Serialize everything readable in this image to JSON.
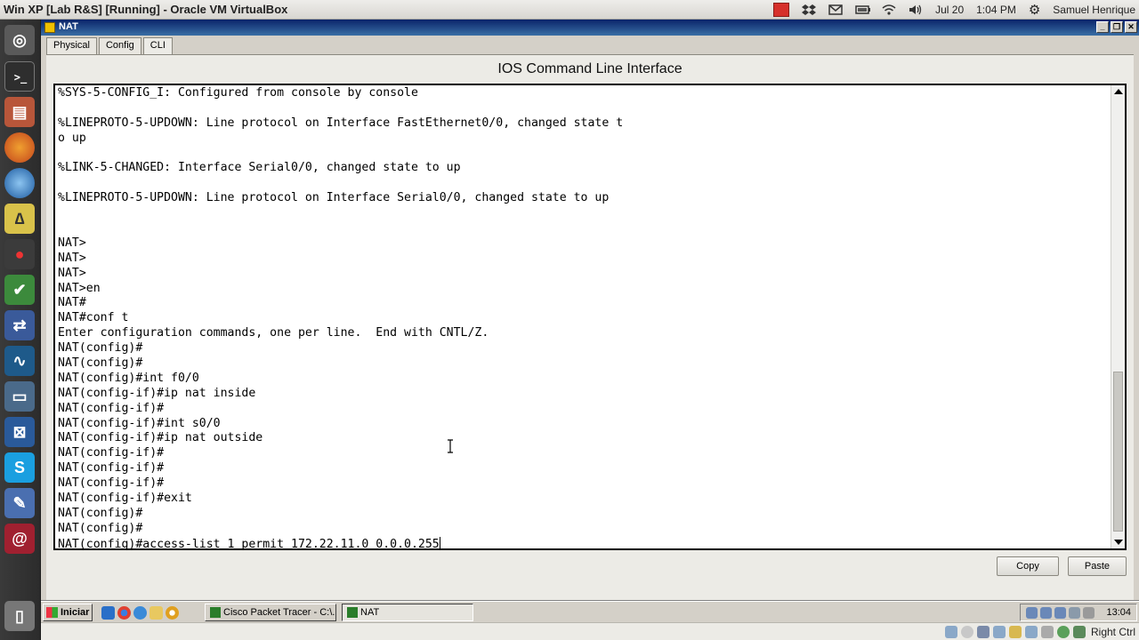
{
  "host": {
    "window_title": "Win XP [Lab R&S] [Running] - Oracle VM VirtualBox",
    "date": "Jul 20",
    "time": "1:04 PM",
    "user": "Samuel Henrique",
    "tray_icons": [
      "stop-icon",
      "dropbox-icon",
      "mail-icon",
      "battery-icon",
      "wifi-icon",
      "volume-icon"
    ]
  },
  "launcher": {
    "items": [
      "ubuntu-logo-icon",
      "terminal-icon",
      "files-icon",
      "firefox-icon",
      "thunderbird-icon",
      "geogebra-icon",
      "molecule-icon",
      "packet-tracer-icon",
      "network-tool-icon",
      "waveform-icon",
      "remote-desktop-icon",
      "virtualbox-icon",
      "skype-icon",
      "document-icon",
      "debian-icon",
      "trash-icon"
    ]
  },
  "window": {
    "title": "NAT"
  },
  "tabs": [
    {
      "label": "Physical"
    },
    {
      "label": "Config"
    },
    {
      "label": "CLI"
    }
  ],
  "cli": {
    "heading": "IOS Command Line Interface",
    "lines": [
      "%SYS-5-CONFIG_I: Configured from console by console",
      "",
      "%LINEPROTO-5-UPDOWN: Line protocol on Interface FastEthernet0/0, changed state t",
      "o up",
      "",
      "%LINK-5-CHANGED: Interface Serial0/0, changed state to up",
      "",
      "%LINEPROTO-5-UPDOWN: Line protocol on Interface Serial0/0, changed state to up",
      "",
      "",
      "NAT>",
      "NAT>",
      "NAT>",
      "NAT>en",
      "NAT#",
      "NAT#conf t",
      "Enter configuration commands, one per line.  End with CNTL/Z.",
      "NAT(config)#",
      "NAT(config)#",
      "NAT(config)#int f0/0",
      "NAT(config-if)#ip nat inside",
      "NAT(config-if)#",
      "NAT(config-if)#int s0/0",
      "NAT(config-if)#ip nat outside",
      "NAT(config-if)#",
      "NAT(config-if)#",
      "NAT(config-if)#",
      "NAT(config-if)#exit",
      "NAT(config)#",
      "NAT(config)#",
      "NAT(config)#access-list 1 permit 172.22.11.0 0.0.0.255"
    ],
    "copy_label": "Copy",
    "paste_label": "Paste"
  },
  "taskbar": {
    "start_label": "Iniciar",
    "tasks": [
      {
        "label": "Cisco Packet Tracer - C:\\..."
      },
      {
        "label": "NAT"
      }
    ],
    "clock": "13:04"
  },
  "vbox_status": {
    "host_key": "Right Ctrl"
  }
}
